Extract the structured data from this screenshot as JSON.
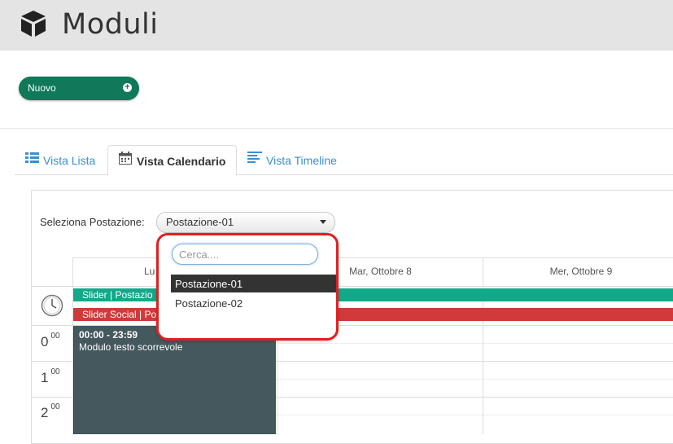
{
  "header": {
    "title": "Moduli",
    "icon": "cube-icon"
  },
  "toolbar": {
    "new_label": "Nuovo"
  },
  "tabs": [
    {
      "label": "Vista Lista",
      "icon": "list-icon",
      "active": false
    },
    {
      "label": "Vista Calendario",
      "icon": "calendar-icon",
      "active": true
    },
    {
      "label": "Vista Timeline",
      "icon": "timeline-icon",
      "active": false
    }
  ],
  "calendar": {
    "station_label": "Seleziona Postazione:",
    "station_value": "Postazione-01",
    "days": [
      "Lu",
      "Mar, Ottobre 8",
      "Mer, Ottobre 9"
    ],
    "allday_events": [
      {
        "label": "Slider | Postazio",
        "color": "#12a98a"
      },
      {
        "label": "Slider Social | Po",
        "color": "#d03a3a"
      }
    ],
    "hours": [
      {
        "h": "0",
        "m": "00"
      },
      {
        "h": "1",
        "m": "00"
      },
      {
        "h": "2",
        "m": "00"
      }
    ],
    "event": {
      "time": "00:00 - 23:59",
      "title": "Modulo testo scorrevole"
    }
  },
  "dropdown": {
    "search_placeholder": "Cerca....",
    "options": [
      {
        "label": "Postazione-01",
        "selected": true
      },
      {
        "label": "Postazione-02",
        "selected": false
      }
    ]
  },
  "colors": {
    "accent_green": "#10795a",
    "highlight": "#e02020",
    "event_bg": "#44585e"
  }
}
